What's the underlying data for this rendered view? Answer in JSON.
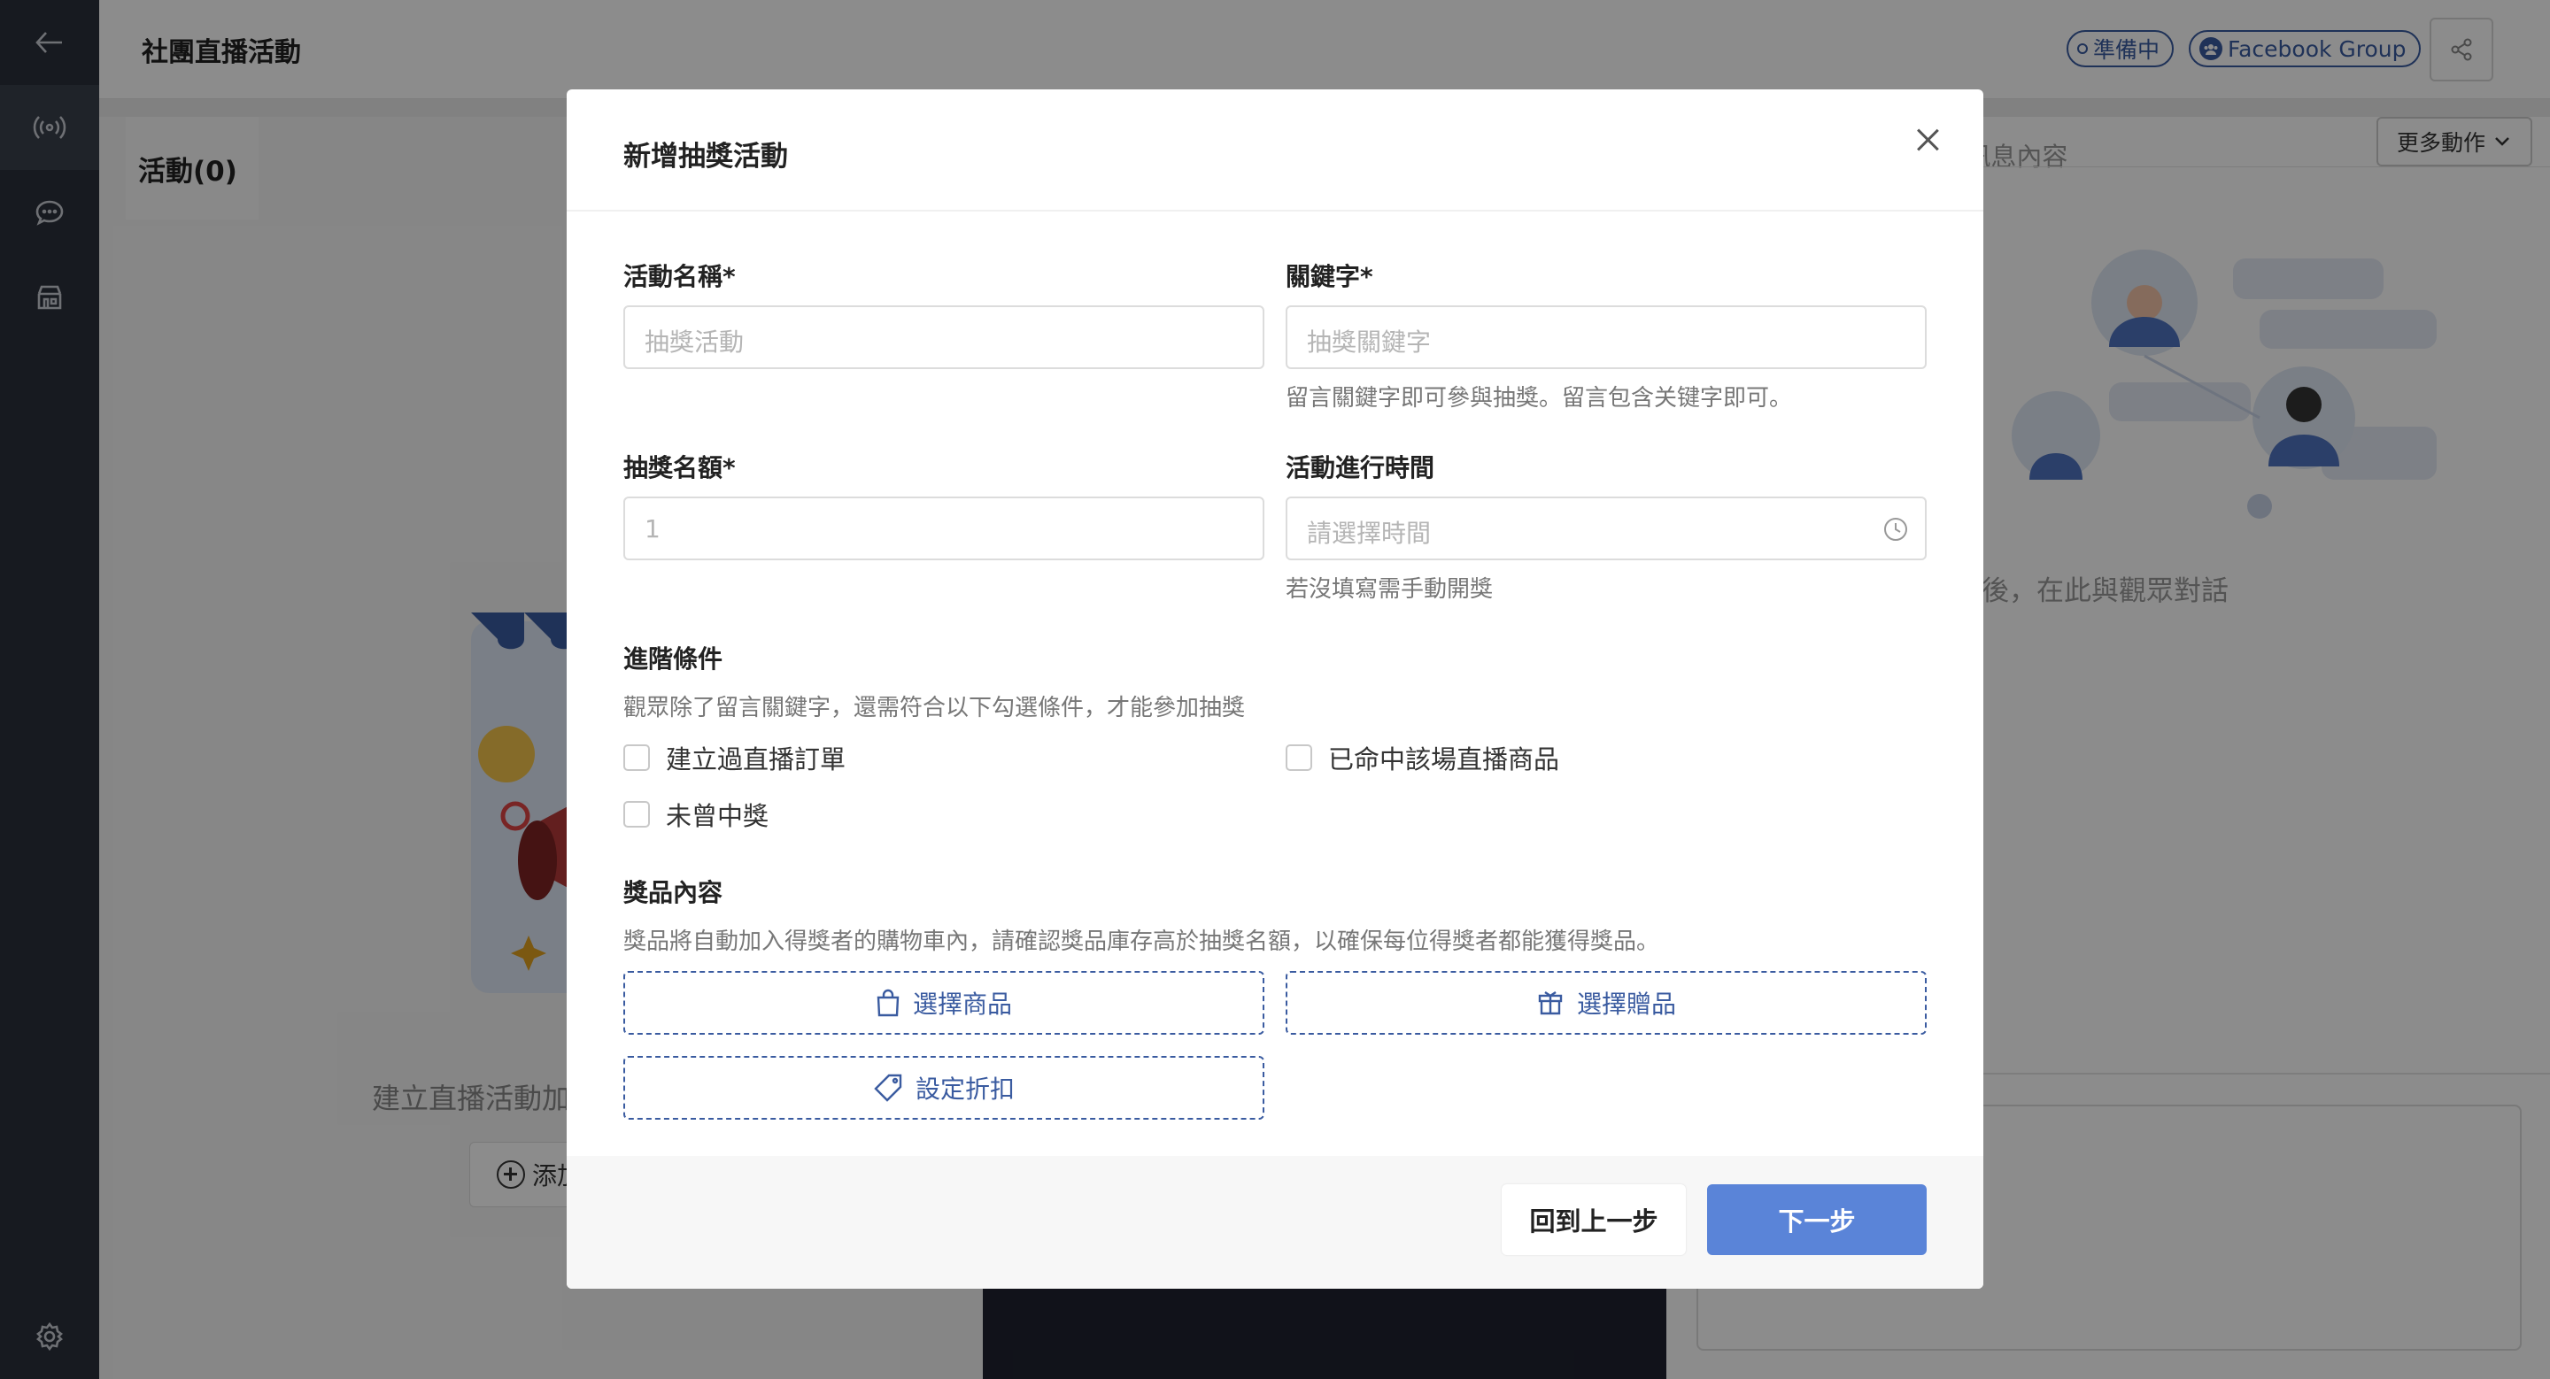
{
  "header": {
    "title": "社團直播活動",
    "status_badge": "準備中",
    "platform_badge": "Facebook Group"
  },
  "left_panel": {
    "tab_label": "活動(0)",
    "empty_caption": "建立直播活動加",
    "add_button": "添加"
  },
  "right_panel": {
    "search_placeholder": "稱, 訊息內容",
    "more_actions": "更多動作",
    "empty_caption": "直播後，在此與觀眾對話"
  },
  "modal": {
    "title": "新增抽獎活動",
    "fields": {
      "activity_name": {
        "label": "活動名稱*",
        "placeholder": "抽獎活動"
      },
      "keyword": {
        "label": "關鍵字*",
        "placeholder": "抽獎關鍵字",
        "help": "留言關鍵字即可參與抽獎。留言包含关键字即可。"
      },
      "winner_count": {
        "label": "抽獎名額*",
        "placeholder": "1"
      },
      "activity_time": {
        "label": "活動進行時間",
        "placeholder": "請選擇時間",
        "help": "若沒填寫需手動開獎"
      }
    },
    "advanced": {
      "title": "進階條件",
      "description": "觀眾除了留言關鍵字，還需符合以下勾選條件，才能參加抽獎",
      "options": [
        "建立過直播訂單",
        "已命中該場直播商品",
        "未曾中獎"
      ]
    },
    "prize": {
      "title": "獎品內容",
      "description": "獎品將自動加入得獎者的購物車內，請確認獎品庫存高於抽獎名額，以確保每位得獎者都能獲得獎品。",
      "select_product": "選擇商品",
      "select_gift": "選擇贈品",
      "set_discount": "設定折扣"
    },
    "footer": {
      "back": "回到上一步",
      "next": "下一步"
    }
  },
  "colors": {
    "accent": "#3a5ba0",
    "primary_button": "#5a84d8",
    "sidebar": "#2b303b"
  }
}
